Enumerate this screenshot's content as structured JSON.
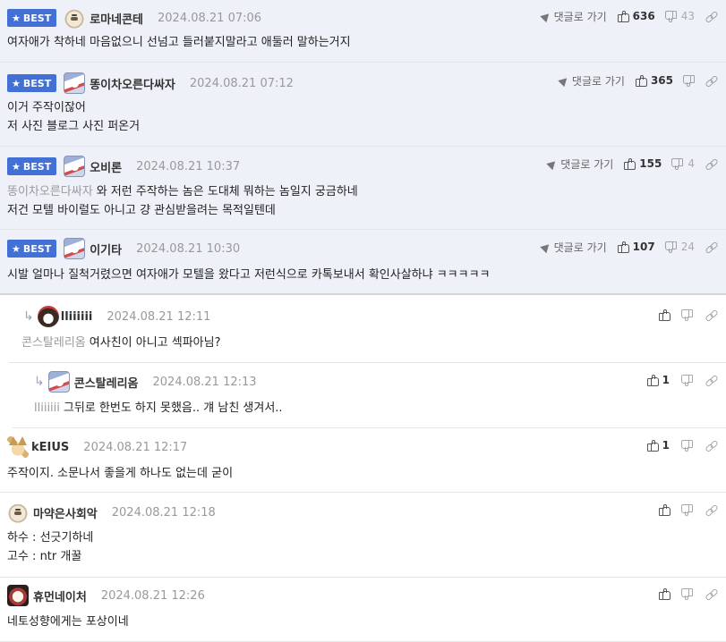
{
  "ui": {
    "goto_label": "댓글로 가기",
    "best_label": "BEST"
  },
  "comments": [
    {
      "nick": "로마네콘테",
      "date": "2024.08.21 07:06",
      "up": "636",
      "down": "43",
      "text": "여자애가 착하네 마음없으니 선넘고 들러붙지말라고 애둘러 말하는거지"
    },
    {
      "nick": "똥이차오른다싸자",
      "date": "2024.08.21 07:12",
      "up": "365",
      "line1": "이거 주작이잖어",
      "line2": "저 사진 블로그 사진 퍼온거"
    },
    {
      "nick": "오비론",
      "date": "2024.08.21 10:37",
      "up": "155",
      "down": "4",
      "mention": "똥이차오른다싸자",
      "line1": "와 저런 주작하는 놈은 도대체 뭐하는 놈일지 궁금하네",
      "line2": "저건 모텔 바이럴도 아니고 걍 관심받을려는 목적일텐데"
    },
    {
      "nick": "이기타",
      "date": "2024.08.21 10:30",
      "up": "107",
      "down": "24",
      "text": "시발 얼마나 질척거렸으면 여자애가 모텔을 왔다고 저런식으로 카톡보내서 확인사살하냐 ㅋㅋㅋㅋㅋ"
    },
    {
      "nick": "lliiiiii",
      "date": "2024.08.21 12:11",
      "mention": "콘스탈레리옴",
      "text": "여사친이 아니고 섹파아님?"
    },
    {
      "nick": "콘스탈레리옴",
      "date": "2024.08.21 12:13",
      "up": "1",
      "mention": "lliiiiii",
      "text": "그뒤로 한번도 하지 못했음.. 걔 남친 생겨서.."
    },
    {
      "nick": "kEIUS",
      "date": "2024.08.21 12:17",
      "up": "1",
      "text": "주작이지. 소문나서 좋을게 하나도 없는데 굳이"
    },
    {
      "nick": "마약은사회악",
      "date": "2024.08.21 12:18",
      "line1": "하수 : 선긋기하네",
      "line2": "고수 : ntr 개꿀"
    },
    {
      "nick": "휴먼네이처",
      "date": "2024.08.21 12:26",
      "text": "네토성향에게는 포상이네"
    }
  ]
}
